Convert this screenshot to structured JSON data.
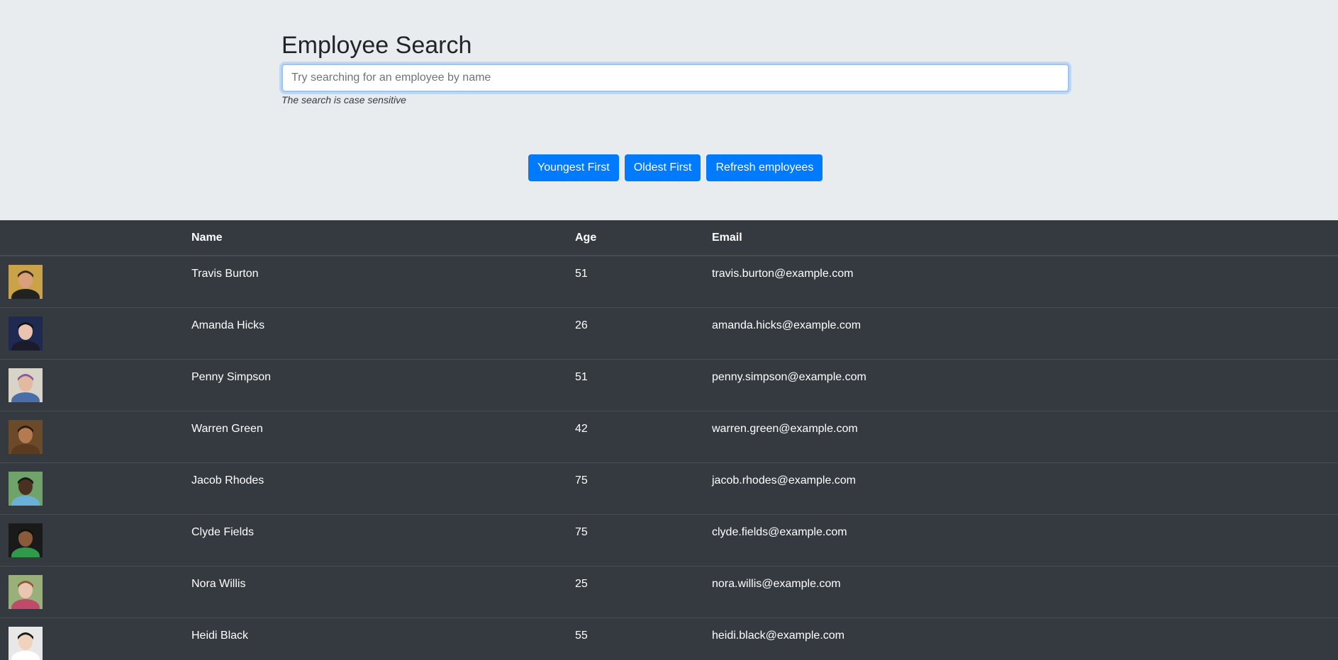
{
  "header": {
    "title": "Employee Search",
    "search_placeholder": "Try searching for an employee by name",
    "search_value": "",
    "hint": "The search is case sensitive"
  },
  "buttons": {
    "youngest": "Youngest First",
    "oldest": "Oldest First",
    "refresh": "Refresh employees"
  },
  "table": {
    "columns": [
      "",
      "Name",
      "Age",
      "Email"
    ],
    "rows": [
      {
        "name": "Travis Burton",
        "age": "51",
        "email": "travis.burton@example.com",
        "avatar": {
          "bg": "#c9a24a",
          "skin": "#d9a07a",
          "hair": "#3b2a1a",
          "shirt": "#222222"
        }
      },
      {
        "name": "Amanda Hicks",
        "age": "26",
        "email": "amanda.hicks@example.com",
        "avatar": {
          "bg": "#1f2a52",
          "skin": "#e8c4b0",
          "hair": "#151515",
          "shirt": "#1b1b2a"
        }
      },
      {
        "name": "Penny Simpson",
        "age": "51",
        "email": "penny.simpson@example.com",
        "avatar": {
          "bg": "#d9d4c8",
          "skin": "#e3b9a0",
          "hair": "#8a5a9a",
          "shirt": "#4a6fa8"
        }
      },
      {
        "name": "Warren Green",
        "age": "42",
        "email": "warren.green@example.com",
        "avatar": {
          "bg": "#6b4a2a",
          "skin": "#b57a4f",
          "hair": "#2a1a10",
          "shirt": "#5a3a20"
        }
      },
      {
        "name": "Jacob Rhodes",
        "age": "75",
        "email": "jacob.rhodes@example.com",
        "avatar": {
          "bg": "#6fa36a",
          "skin": "#4a3020",
          "hair": "#1a1a1a",
          "shirt": "#6ab0d8"
        }
      },
      {
        "name": "Clyde Fields",
        "age": "75",
        "email": "clyde.fields@example.com",
        "avatar": {
          "bg": "#1a1a1a",
          "skin": "#8a5a3a",
          "hair": "#111111",
          "shirt": "#2e9a4a"
        }
      },
      {
        "name": "Nora Willis",
        "age": "25",
        "email": "nora.willis@example.com",
        "avatar": {
          "bg": "#9ab07a",
          "skin": "#eac6b0",
          "hair": "#8a5a3a",
          "shirt": "#c04a6a"
        }
      },
      {
        "name": "Heidi Black",
        "age": "55",
        "email": "heidi.black@example.com",
        "avatar": {
          "bg": "#e8e8e8",
          "skin": "#f0d2bd",
          "hair": "#1a1a1a",
          "shirt": "#ffffff"
        }
      }
    ]
  }
}
